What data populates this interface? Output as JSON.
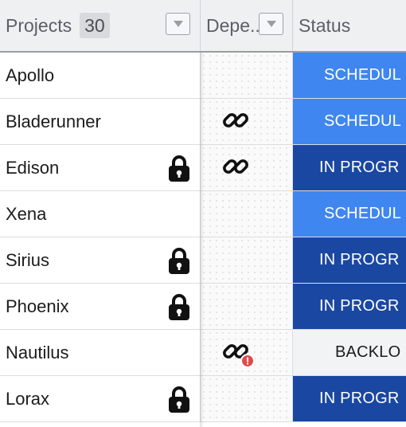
{
  "header": {
    "projects_label": "Projects",
    "projects_count": "30",
    "dependencies_label": "Depe...",
    "status_label": "Status"
  },
  "colors": {
    "scheduled": "#3f86f0",
    "in_progress": "#1a47a1",
    "backlog": "#f2f3f5",
    "header_bg": "#eff0f2",
    "warning": "#e04b4b"
  },
  "rows": [
    {
      "name": "Apollo",
      "locked": false,
      "dependency": "none",
      "status": "SCHEDULED",
      "status_visible": "SCHEDUL",
      "status_kind": "scheduled"
    },
    {
      "name": "Bladerunner",
      "locked": false,
      "dependency": "link-icon",
      "status": "SCHEDULED",
      "status_visible": "SCHEDUL",
      "status_kind": "scheduled"
    },
    {
      "name": "Edison",
      "locked": true,
      "dependency": "link-icon",
      "status": "IN PROGRESS",
      "status_visible": "IN PROGR",
      "status_kind": "inprogress"
    },
    {
      "name": "Xena",
      "locked": false,
      "dependency": "none",
      "status": "SCHEDULED",
      "status_visible": "SCHEDUL",
      "status_kind": "scheduled"
    },
    {
      "name": "Sirius",
      "locked": true,
      "dependency": "none",
      "status": "IN PROGRESS",
      "status_visible": "IN PROGR",
      "status_kind": "inprogress"
    },
    {
      "name": "Phoenix",
      "locked": true,
      "dependency": "none",
      "status": "IN PROGRESS",
      "status_visible": "IN PROGR",
      "status_kind": "inprogress"
    },
    {
      "name": "Nautilus",
      "locked": false,
      "dependency": "link-warning-icon",
      "status": "BACKLOG",
      "status_visible": "BACKLO",
      "status_kind": "backlog"
    },
    {
      "name": "Lorax",
      "locked": true,
      "dependency": "none",
      "status": "IN PROGRESS",
      "status_visible": "IN PROGR",
      "status_kind": "inprogress"
    }
  ]
}
